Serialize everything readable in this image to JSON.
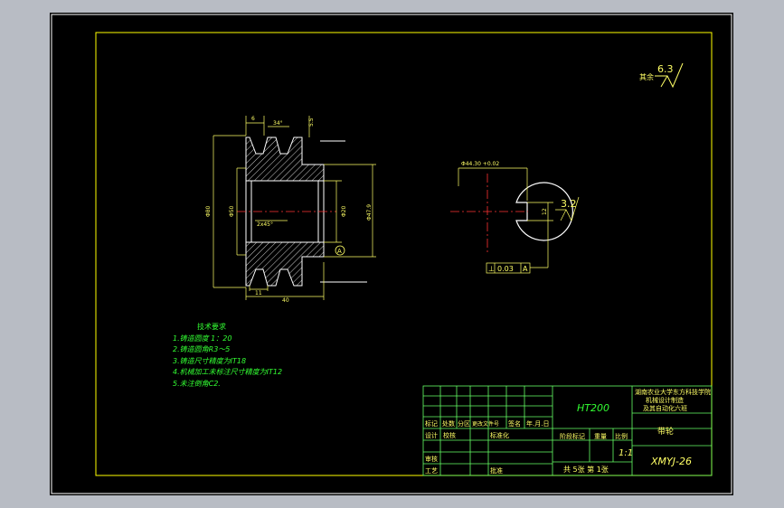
{
  "colors": {
    "viewport_bg": "#000000",
    "app_chrome": "#b8bcc4",
    "outer_border": "#ffffff",
    "frame": "#ffff00",
    "geometry": "#ffffff",
    "dimension": "#ffff66",
    "center_line": "#ff3333",
    "notes": "#33ff33",
    "title_block_lines": "#66ff66",
    "title_text": "#ffff66",
    "material": "#33ff33"
  },
  "roughness": {
    "label": "其余",
    "value": "6.3"
  },
  "side_view": {
    "dim_top_small": "6",
    "dim_top_angle": "34°",
    "dim_right_small": "5.5",
    "dim_outer_dia": "Φ80",
    "dim_inner_dia": "Φ50",
    "dim_bore": "Φ20",
    "dim_hub": "Φ47.9",
    "dim_chamfer": "2x45°",
    "dim_bottom_small": "11",
    "dim_bottom_len": "40",
    "datum": "A"
  },
  "front_view": {
    "dim_keyway_top": "Φ44.30 +0.02",
    "dim_keyway_side": "12",
    "roughness_value": "3.2",
    "tolerance_symbol": "⊥",
    "tolerance_value": "0.03",
    "tolerance_datum": "A"
  },
  "tech_notes": {
    "title": "技术要求",
    "items": [
      "1.铸造圆度 1：20",
      "2.铸造圆角R3～5",
      "3.铸造尺寸精度为IT18",
      "4.机械加工未标注尺寸精度为IT12",
      "5.未注倒角C2."
    ]
  },
  "title_block": {
    "material": "HT200",
    "school_line1": "湖南农业大学东方科技学院",
    "school_line2": "机械设计制造",
    "school_line3": "及其自动化六班",
    "part_name": "带轮",
    "drawing_no": "XMYJ-26",
    "scale": "1:1",
    "sheet_info": "共 5张 第 1张",
    "row_labels": [
      "标记",
      "处数",
      "分区",
      "更改文件号",
      "签名",
      "年.月.日"
    ],
    "design": "设计",
    "check": "校核",
    "standard": "标准化",
    "stage_mark": "阶段标记",
    "weight": "重量",
    "ratio": "比例",
    "review": "审核",
    "process": "工艺",
    "approve": "批准"
  }
}
